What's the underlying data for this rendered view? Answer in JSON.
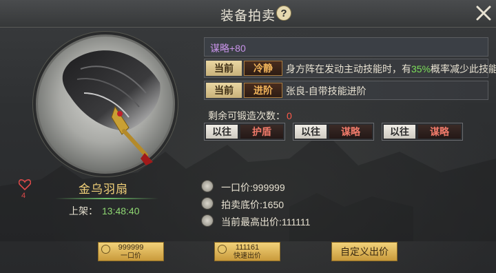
{
  "header": {
    "title": "装备拍卖",
    "help_icon": "question-mark-icon",
    "close_icon": "close-x-icon"
  },
  "item": {
    "name": "金乌羽扇",
    "favorites": "4",
    "list_label": "上架：",
    "list_time": "13:48:40"
  },
  "attributes": {
    "stat": "谋略+80",
    "rows": [
      {
        "tag": "当前",
        "skill": "冷静",
        "desc_prefix": "身方阵在发动主动技能时，有",
        "pct": "35%",
        "desc_suffix": "概率减少此技能"
      },
      {
        "tag": "当前",
        "skill": "进阶",
        "desc": "张良-自带技能进阶"
      }
    ]
  },
  "forge": {
    "label": "剩余可锻造次数：",
    "count": "0"
  },
  "previous": [
    {
      "tag": "以往",
      "skill": "护盾"
    },
    {
      "tag": "以往",
      "skill": "谋略"
    },
    {
      "tag": "以往",
      "skill": "谋略"
    }
  ],
  "prices": {
    "buyout": "一口价:999999",
    "reserve": "拍卖底价:1650",
    "highest": "当前最高出价:111111"
  },
  "buttons": {
    "buyout_amount": "999999",
    "buyout_label": "一口价",
    "quick_amount": "111161",
    "quick_label": "快速出价",
    "custom_label": "自定义出价"
  },
  "colors": {
    "gold": "#f4d37a",
    "purple_stat": "#c994ea",
    "green_pct": "#7de05a",
    "red_count": "#ff5a4a"
  }
}
